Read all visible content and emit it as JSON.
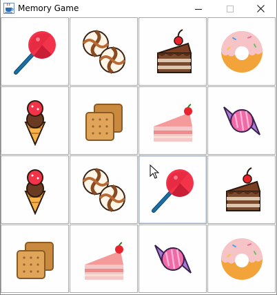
{
  "window": {
    "title": "Memory Game",
    "icon": "java-cup-icon",
    "controls": [
      "minimize-icon",
      "maximize-icon",
      "close-icon"
    ]
  },
  "board": {
    "rows": 4,
    "columns": 4,
    "cards": [
      {
        "row": 0,
        "col": 0,
        "icon": "lollipop"
      },
      {
        "row": 0,
        "col": 1,
        "icon": "swirl-candies"
      },
      {
        "row": 0,
        "col": 2,
        "icon": "chocolate-cake"
      },
      {
        "row": 0,
        "col": 3,
        "icon": "donut"
      },
      {
        "row": 1,
        "col": 0,
        "icon": "ice-cream-cone"
      },
      {
        "row": 1,
        "col": 1,
        "icon": "biscuits"
      },
      {
        "row": 1,
        "col": 2,
        "icon": "strawberry-cake"
      },
      {
        "row": 1,
        "col": 3,
        "icon": "wrapped-candy"
      },
      {
        "row": 2,
        "col": 0,
        "icon": "ice-cream-cone"
      },
      {
        "row": 2,
        "col": 1,
        "icon": "swirl-candies"
      },
      {
        "row": 2,
        "col": 2,
        "icon": "lollipop",
        "state": "focused"
      },
      {
        "row": 2,
        "col": 3,
        "icon": "chocolate-cake"
      },
      {
        "row": 3,
        "col": 0,
        "icon": "biscuits"
      },
      {
        "row": 3,
        "col": 1,
        "icon": "strawberry-cake"
      },
      {
        "row": 3,
        "col": 2,
        "icon": "wrapped-candy"
      },
      {
        "row": 3,
        "col": 3,
        "icon": "donut"
      }
    ]
  },
  "pointer": "arrow-cursor-icon",
  "colors": {
    "card_border": "#a9a9a9",
    "focus_border": "#7aa2d6",
    "lollipop_red": "#f2334a",
    "stick_blue": "#1b6fa3",
    "cake_chocolate": "#6b3a22",
    "cake_pink": "#f59a9a",
    "candy_pink": "#f06aa8",
    "candy_purple": "#a97ad6",
    "donut_dough": "#f2a33a",
    "biscuit": "#d99a4e",
    "cone": "#f5b14a"
  }
}
